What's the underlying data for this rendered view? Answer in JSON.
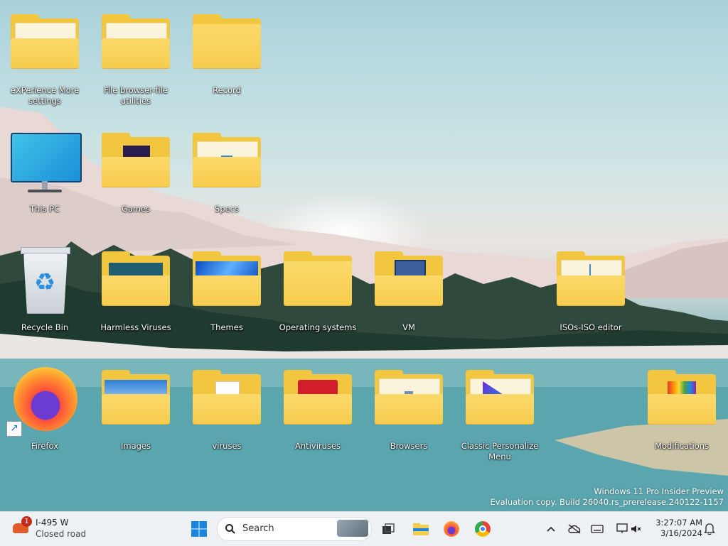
{
  "desktop": {
    "icons": [
      {
        "label": "eXPerience More settings",
        "icon": "folder-icon"
      },
      {
        "label": "File browser-file utilities",
        "icon": "folder-icon"
      },
      {
        "label": "Record",
        "icon": "folder-icon"
      },
      {
        "label": "This PC",
        "icon": "monitor-icon"
      },
      {
        "label": "Games",
        "icon": "folder-icon"
      },
      {
        "label": "Specs",
        "icon": "folder-icon"
      },
      {
        "label": "Recycle Bin",
        "icon": "recycle-bin-icon"
      },
      {
        "label": "Harmless Viruses",
        "icon": "folder-icon"
      },
      {
        "label": "Themes",
        "icon": "folder-icon"
      },
      {
        "label": "Operating systems",
        "icon": "folder-icon"
      },
      {
        "label": "VM",
        "icon": "folder-icon"
      },
      {
        "label": "ISOs-ISO editor",
        "icon": "folder-icon"
      },
      {
        "label": "Firefox",
        "icon": "firefox-icon"
      },
      {
        "label": "Images",
        "icon": "folder-icon"
      },
      {
        "label": "viruses",
        "icon": "folder-icon"
      },
      {
        "label": "Antiviruses",
        "icon": "folder-icon"
      },
      {
        "label": "Browsers",
        "icon": "folder-icon"
      },
      {
        "label": "Classic Personalize Menu",
        "icon": "folder-icon"
      },
      {
        "label": "Modifications",
        "icon": "folder-icon"
      }
    ]
  },
  "watermark": {
    "line1": "Windows 11 Pro Insider Preview",
    "line2": "Evaluation copy. Build 26040.rs_prerelease.240122-1157"
  },
  "taskbar": {
    "weather": {
      "badge": "1",
      "title": "I-495 W",
      "subtitle": "Closed road"
    },
    "search_placeholder": "Search",
    "pinned": [
      "start-icon",
      "task-view-icon",
      "file-explorer-icon",
      "firefox-icon",
      "chrome-icon"
    ],
    "clock": {
      "time": "3:27:07 AM",
      "date": "3/16/2024"
    }
  },
  "colors": {
    "folder": "#f3c640",
    "taskbar": "#eef1f4",
    "accent": "#0067c0"
  }
}
